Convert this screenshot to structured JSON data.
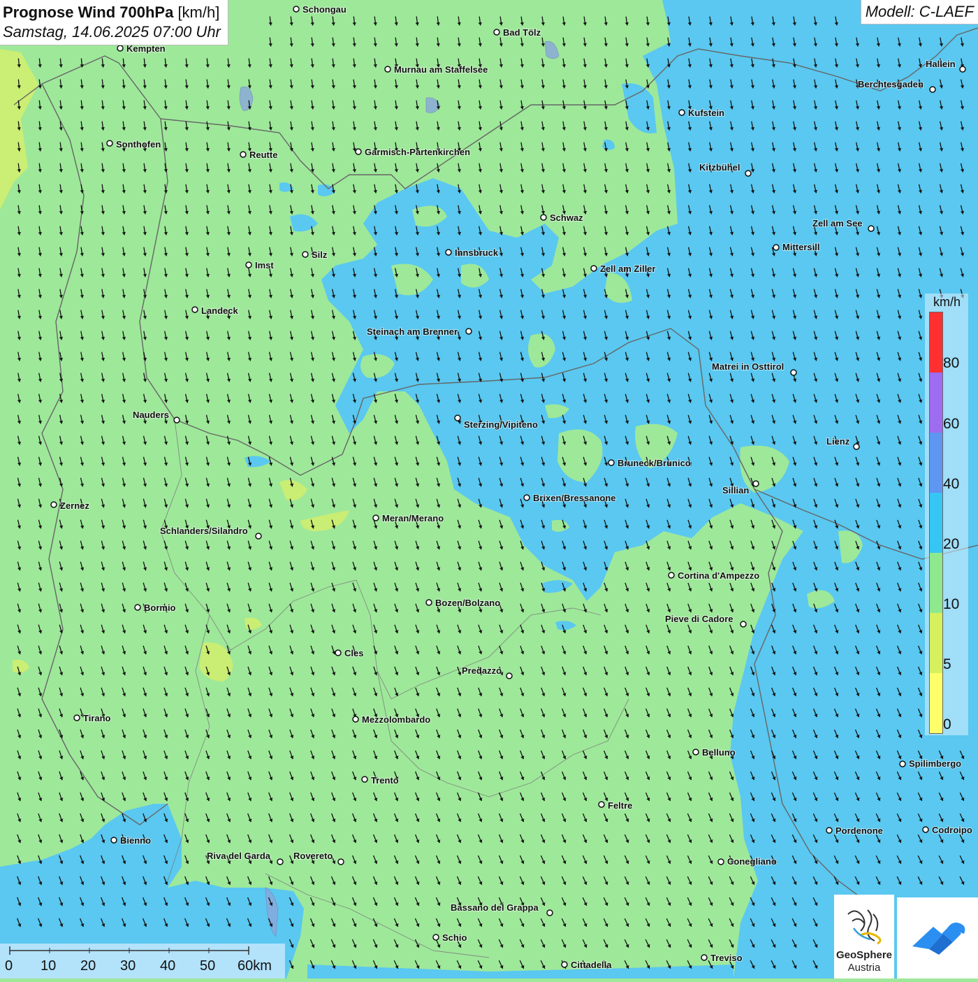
{
  "title": {
    "main": "Prognose Wind 700hPa",
    "unit": "[km/h]",
    "datetime": "Samstag, 14.06.2025 07:00 Uhr"
  },
  "model": "Modell: C-LAEF",
  "legend": {
    "unit": "km/h",
    "ticks": [
      "80",
      "60",
      "40",
      "20",
      "10",
      "5",
      "0"
    ],
    "colors": [
      "#ff3030",
      "#9d6cf0",
      "#5f96f2",
      "#36c6f4",
      "#8ee88e",
      "#d6f060",
      "#ffff6a"
    ]
  },
  "colors": {
    "wind_0_5": "#f2f76a",
    "wind_5_10": "#c4ee6a",
    "wind_10_20": "#9ee89a",
    "wind_20_40": "#5ac8f0"
  },
  "scalebar": {
    "labels": [
      "0",
      "10",
      "20",
      "30",
      "40",
      "50",
      "60km"
    ]
  },
  "logo": {
    "line1": "GeoSphere",
    "line2": "Austria"
  },
  "cities": [
    {
      "name": "Schongau"
    },
    {
      "name": "Bad Tölz"
    },
    {
      "name": "Kempten"
    },
    {
      "name": "Murnau am Staffelsee"
    },
    {
      "name": "Hallein"
    },
    {
      "name": "Berchtesgaden"
    },
    {
      "name": "Kufstein"
    },
    {
      "name": "Sonthofen"
    },
    {
      "name": "Reutte"
    },
    {
      "name": "Garmisch-Partenkirchen"
    },
    {
      "name": "Kitzbühel"
    },
    {
      "name": "Schwaz"
    },
    {
      "name": "Zell am See"
    },
    {
      "name": "Mittersill"
    },
    {
      "name": "Innsbruck"
    },
    {
      "name": "Silz"
    },
    {
      "name": "Imst"
    },
    {
      "name": "Zell am Ziller"
    },
    {
      "name": "Landeck"
    },
    {
      "name": "Steinach am Brenner"
    },
    {
      "name": "Matrei in Osttirol"
    },
    {
      "name": "Nauders"
    },
    {
      "name": "Sterzing/Vipiteno"
    },
    {
      "name": "Lienz"
    },
    {
      "name": "Bruneck/Brunico"
    },
    {
      "name": "Sillian"
    },
    {
      "name": "Brixen/Bressanone"
    },
    {
      "name": "Zernez"
    },
    {
      "name": "Meran/Merano"
    },
    {
      "name": "Schlanders/Silandro"
    },
    {
      "name": "Cortina d'Ampezzo"
    },
    {
      "name": "Bozen/Bolzano"
    },
    {
      "name": "Bormio"
    },
    {
      "name": "Pieve di Cadore"
    },
    {
      "name": "Cles"
    },
    {
      "name": "Predazzo"
    },
    {
      "name": "Tirano"
    },
    {
      "name": "Mezzolombardo"
    },
    {
      "name": "Belluno"
    },
    {
      "name": "Spilimbergo"
    },
    {
      "name": "Trento"
    },
    {
      "name": "Feltre"
    },
    {
      "name": "Bienno"
    },
    {
      "name": "Pordenone"
    },
    {
      "name": "Codroipo"
    },
    {
      "name": "Riva del Garda"
    },
    {
      "name": "Rovereto"
    },
    {
      "name": "Conegliano"
    },
    {
      "name": "Bassano del Grappa"
    },
    {
      "name": "Schio"
    },
    {
      "name": "Treviso"
    },
    {
      "name": "Cittadella"
    }
  ]
}
